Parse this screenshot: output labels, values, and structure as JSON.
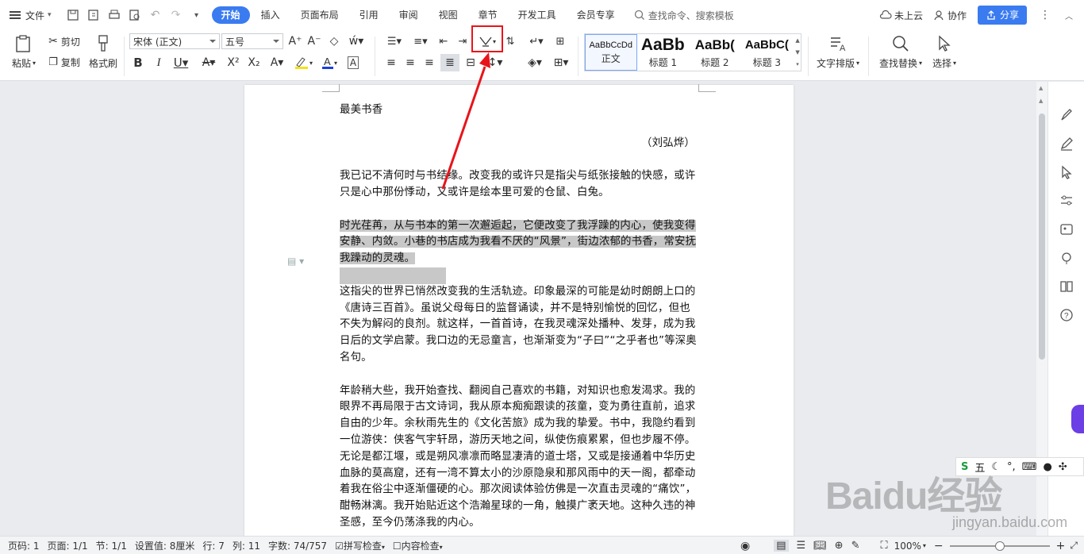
{
  "topbar": {
    "file_menu": "文件",
    "tabs": [
      {
        "label": "开始",
        "active": true
      },
      {
        "label": "插入"
      },
      {
        "label": "页面布局"
      },
      {
        "label": "引用"
      },
      {
        "label": "审阅"
      },
      {
        "label": "视图"
      },
      {
        "label": "章节"
      },
      {
        "label": "开发工具"
      },
      {
        "label": "会员专享"
      }
    ],
    "search_placeholder": "查找命令、搜索模板",
    "cloud_status": "未上云",
    "collaborate": "协作",
    "share": "分享"
  },
  "ribbon": {
    "paste": "粘贴",
    "cut": "剪切",
    "copy": "复制",
    "format_painter": "格式刷",
    "font_name": "宋体 (正文)",
    "font_size": "五号",
    "styles": [
      {
        "preview": "AaBbCcDd",
        "name": "正文"
      },
      {
        "preview": "AaBb",
        "name": "标题 1"
      },
      {
        "preview": "AaBb(",
        "name": "标题 2"
      },
      {
        "preview": "AaBbC(",
        "name": "标题 3"
      }
    ],
    "text_layout": "文字排版",
    "find_replace": "查找替换",
    "select": "选择"
  },
  "document": {
    "title": "最美书香",
    "author": "（刘弘烨）",
    "paragraphs": [
      "我已记不清何时与书结缘。改变我的或许只是指尖与纸张接触的快感，或许只是心中那份悸动，又或许是绘本里可爱的仓鼠、白兔。",
      "时光荏苒，从与书本的第一次邂逅起，它便改变了我浮躁的内心，使我变得安静、内敛。小巷的书店成为我看不厌的“风景”，街边浓郁的书香，常安抚我躁动的灵魂。",
      "这指尖的世界已悄然改变我的生活轨迹。印象最深的可能是幼时朗朗上口的《唐诗三百首》。虽说父母每日的监督诵读，并不是特别愉悦的回忆，但也不失为解闷的良剂。就这样，一首首诗，在我灵魂深处播种、发芽，成为我日后的文学启蒙。我口边的无忌童言，也渐渐变为“子曰”“之乎者也”等深奥名句。",
      "年龄稍大些，我开始查找、翻阅自己喜欢的书籍，对知识也愈发渴求。我的眼界不再局限于古文诗词，我从原本痴痴跟读的孩童，变为勇往直前，追求自由的少年。余秋雨先生的《文化苦旅》成为我的挚爱。书中，我隐约看到一位游侠：侠客气宇轩昂，游历天地之间，纵使伤痕累累，但也步履不停。无论是都江堰，或是朔风凛凛而略显凄清的道士塔，又或是接通着中华历史血脉的莫高窟，还有一湾不算太小的沙原隐泉和那风雨中的天一阁，都牵动着我在俗尘中逐渐僵硬的心。那次阅读体验仿佛是一次直击灵魂的“痛饮”，酣畅淋漓。我开始贴近这个浩瀚星球的一角，触摸广袤天地。这种久违的神圣感，至今仍荡涤我的内心。"
    ]
  },
  "floating_toolbar": {
    "label": "五"
  },
  "watermark": {
    "text": "Baidu经验",
    "url": "jingyan.baidu.com"
  },
  "statusbar": {
    "page_code": "页码: 1",
    "page": "页面: 1/1",
    "section": "节: 1/1",
    "setting": "设置值: 8厘米",
    "row": "行: 7",
    "col": "列: 11",
    "word_count": "字数: 74/757",
    "spell_check": "拼写检查",
    "content_check": "内容检查",
    "zoom": "100%",
    "zoom_fraction": 0.5
  },
  "colors": {
    "accent": "#3a7bf0",
    "highlight_box": "#e8141b",
    "selection": "#c8c8c8"
  }
}
